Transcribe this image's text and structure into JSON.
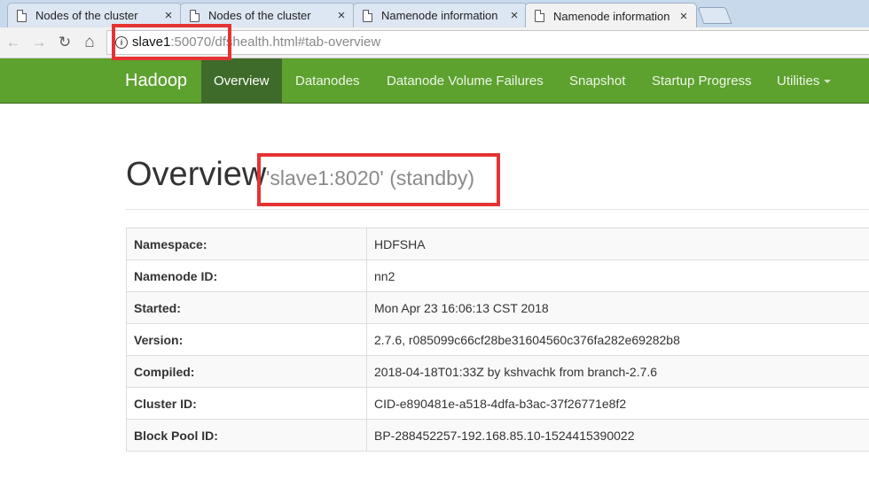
{
  "browser": {
    "tabs": [
      {
        "title": "Nodes of the cluster",
        "close": "×"
      },
      {
        "title": "Nodes of the cluster",
        "close": "×"
      },
      {
        "title": "Namenode information",
        "close": "×"
      },
      {
        "title": "Namenode information",
        "close": "×"
      }
    ],
    "nav": {
      "back": "←",
      "forward": "→",
      "reload": "↻",
      "home": "⌂"
    },
    "url": {
      "host": "slave1",
      "rest": ":50070/dfshealth.html#tab-overview",
      "info": "i"
    }
  },
  "navbar": {
    "brand": "Hadoop",
    "items": [
      "Overview",
      "Datanodes",
      "Datanode Volume Failures",
      "Snapshot",
      "Startup Progress",
      "Utilities"
    ]
  },
  "page": {
    "title": "Overview",
    "subtitle": "'slave1:8020' (standby)"
  },
  "table": {
    "rows": [
      {
        "key": "Namespace:",
        "value": "HDFSHA"
      },
      {
        "key": "Namenode ID:",
        "value": "nn2"
      },
      {
        "key": "Started:",
        "value": "Mon Apr 23 16:06:13 CST 2018"
      },
      {
        "key": "Version:",
        "value": "2.7.6, r085099c66cf28be31604560c376fa282e69282b8"
      },
      {
        "key": "Compiled:",
        "value": "2018-04-18T01:33Z by kshvachk from branch-2.7.6"
      },
      {
        "key": "Cluster ID:",
        "value": "CID-e890481e-a518-4dfa-b3ac-37f26771e8f2"
      },
      {
        "key": "Block Pool ID:",
        "value": "BP-288452257-192.168.85.10-1524415390022"
      }
    ]
  },
  "colors": {
    "navbar": "#5da12e",
    "navbar_active": "#3f6b2a",
    "annotation": "#e53333"
  }
}
